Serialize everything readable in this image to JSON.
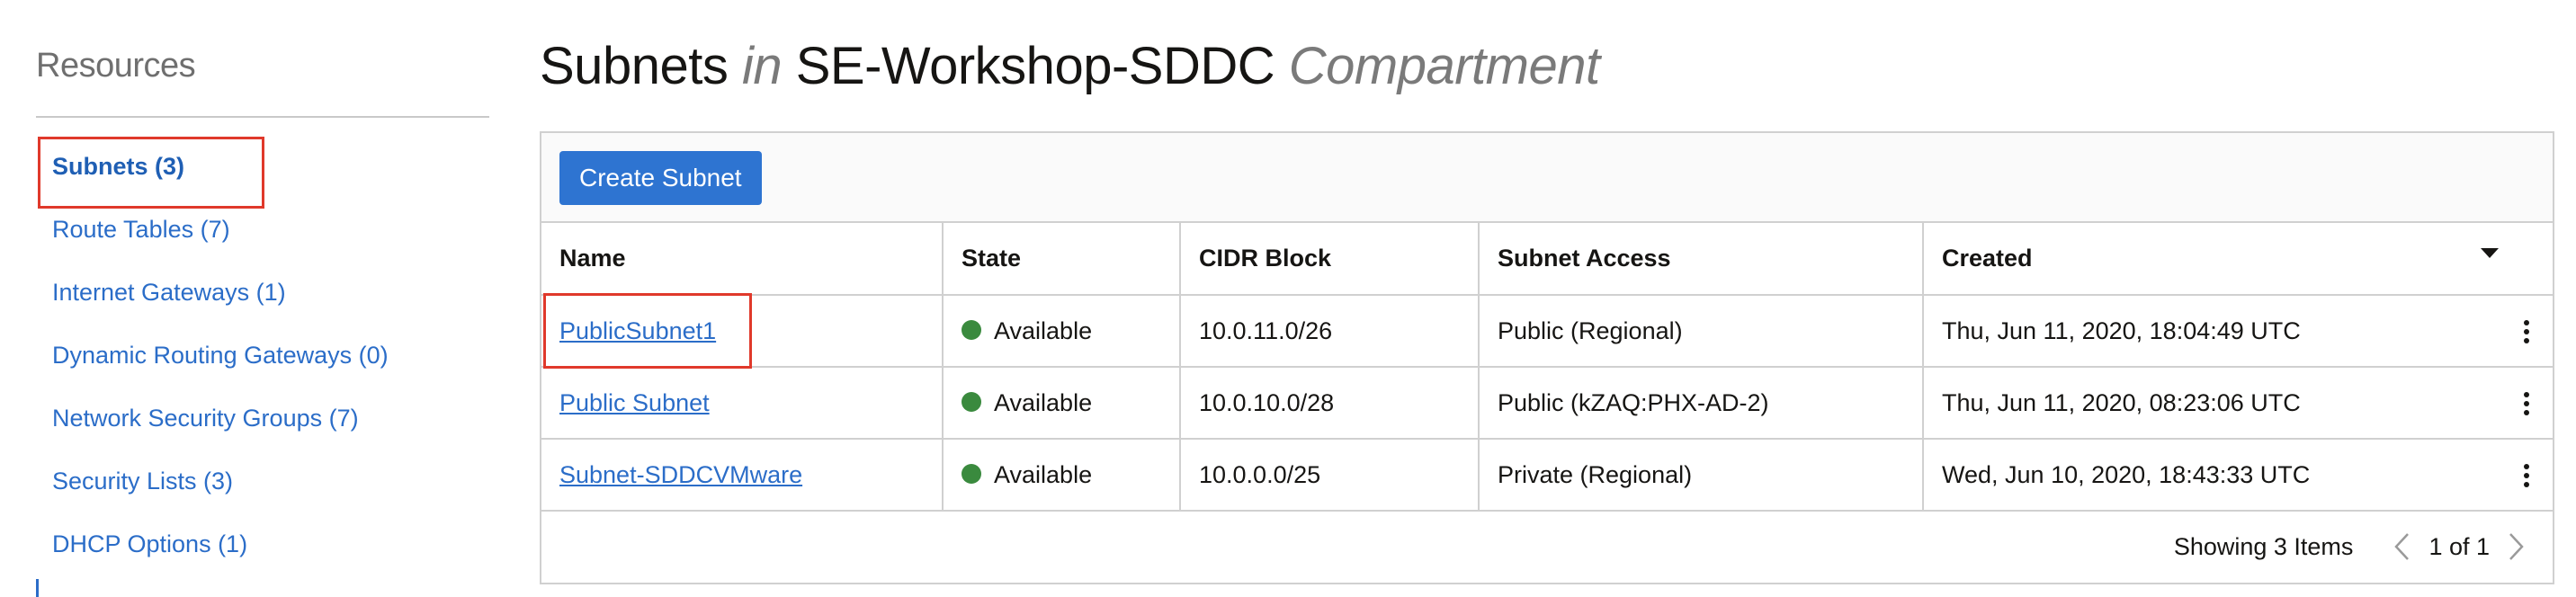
{
  "sidebar": {
    "title": "Resources",
    "items": [
      {
        "label": "Subnets (3)",
        "active": true
      },
      {
        "label": "Route Tables (7)",
        "active": false
      },
      {
        "label": "Internet Gateways (1)",
        "active": false
      },
      {
        "label": "Dynamic Routing Gateways (0)",
        "active": false
      },
      {
        "label": "Network Security Groups (7)",
        "active": false
      },
      {
        "label": "Security Lists (3)",
        "active": false
      },
      {
        "label": "DHCP Options (1)",
        "active": false
      }
    ]
  },
  "header": {
    "title_main": "Subnets",
    "title_in": "in",
    "title_compartment": "SE-Workshop-SDDC",
    "title_suffix": "Compartment"
  },
  "toolbar": {
    "create_label": "Create Subnet"
  },
  "table": {
    "columns": [
      "Name",
      "State",
      "CIDR Block",
      "Subnet Access",
      "Created"
    ],
    "rows": [
      {
        "name": "PublicSubnet1",
        "state": "Available",
        "cidr": "10.0.11.0/26",
        "access": "Public (Regional)",
        "created": "Thu, Jun 11, 2020, 18:04:49 UTC"
      },
      {
        "name": "Public Subnet",
        "state": "Available",
        "cidr": "10.0.10.0/28",
        "access": "Public (kZAQ:PHX-AD-2)",
        "created": "Thu, Jun 11, 2020, 08:23:06 UTC"
      },
      {
        "name": "Subnet-SDDCVMware",
        "state": "Available",
        "cidr": "10.0.0.0/25",
        "access": "Private (Regional)",
        "created": "Wed, Jun 10, 2020, 18:43:33 UTC"
      }
    ]
  },
  "footer": {
    "count_text": "Showing 3 Items",
    "page_text": "1 of 1"
  },
  "colors": {
    "accent": "#2b6dc8",
    "button": "#2e74d1",
    "available": "#3a8a3e",
    "highlight": "#e0392b"
  },
  "icons": {
    "prev": "chevron-left-icon",
    "next": "chevron-right-icon",
    "row_actions": "kebab-menu-icon",
    "sort": "caret-down-icon",
    "status": "status-dot-icon"
  }
}
